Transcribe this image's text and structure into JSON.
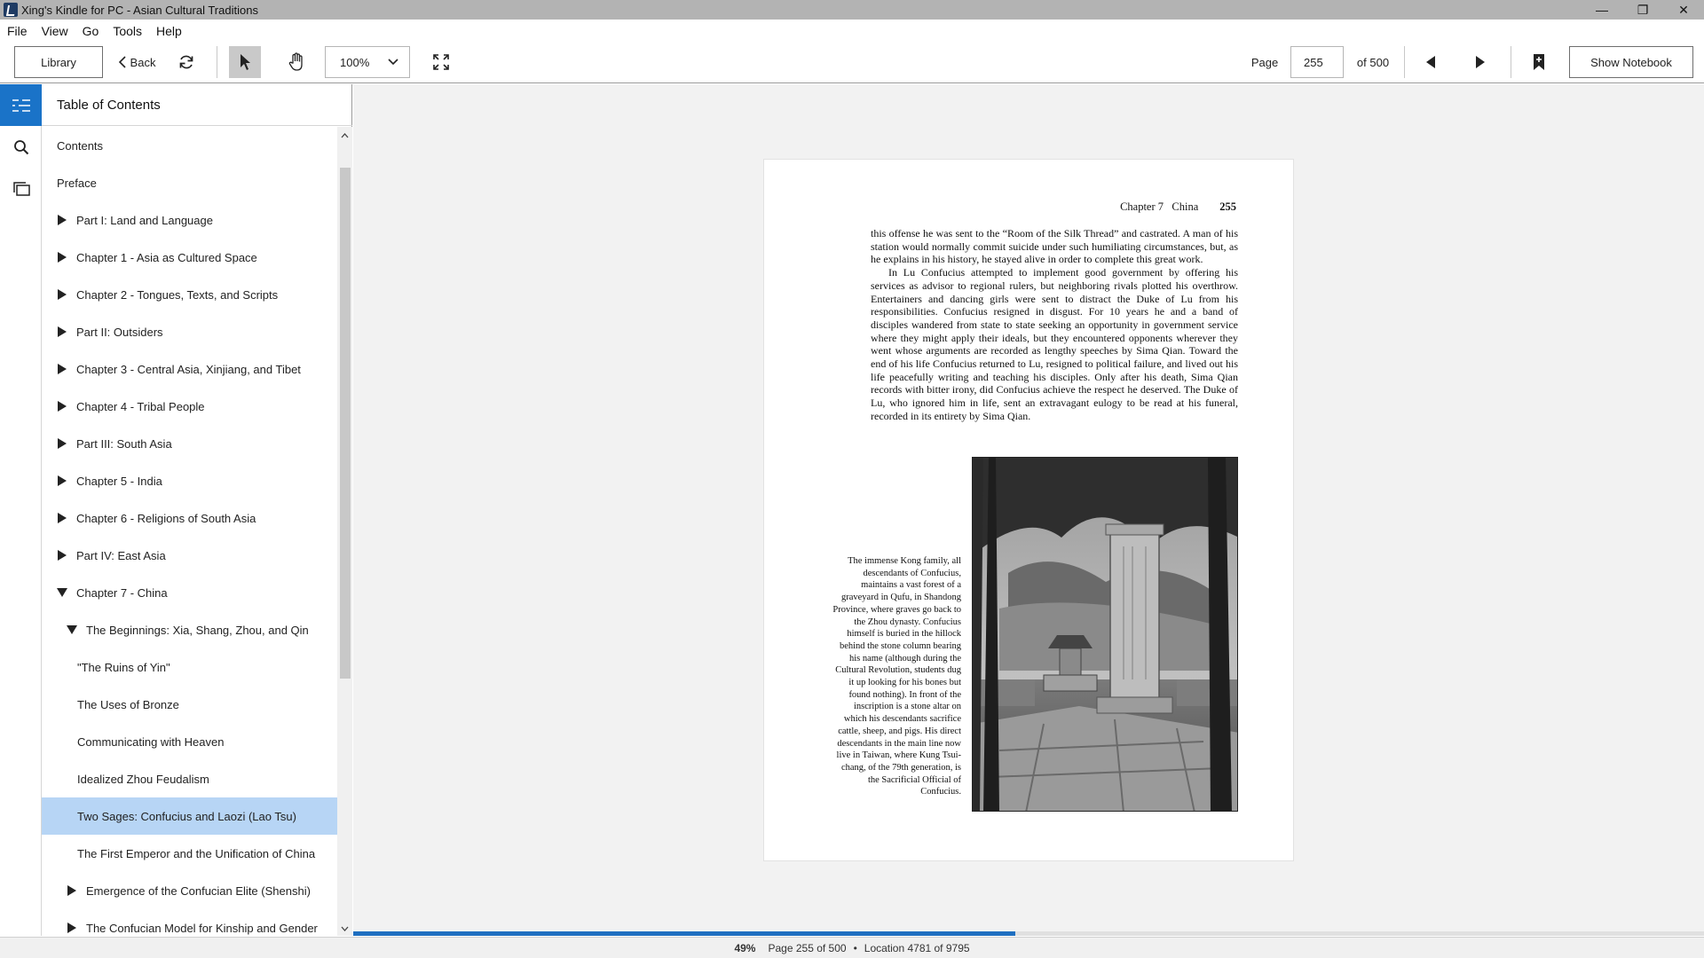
{
  "window": {
    "title": "Xing's Kindle for PC - Asian Cultural Traditions",
    "minimize": "—",
    "restore": "❐",
    "close": "✕"
  },
  "menu": {
    "items": [
      {
        "label": "File"
      },
      {
        "label": "View"
      },
      {
        "label": "Go"
      },
      {
        "label": "Tools"
      },
      {
        "label": "Help"
      }
    ]
  },
  "toolbar": {
    "library_label": "Library",
    "back_label": "Back",
    "zoom_value": "100%",
    "page_label": "Page",
    "page_value": "255",
    "page_of": "of 500",
    "notebook_label": "Show Notebook"
  },
  "icons": {
    "menu": "toc-list-icon",
    "search": "search-icon",
    "cards": "flashcards-icon"
  },
  "colors": {
    "accent": "#1a73c8",
    "selected_row": "#b7d5f5",
    "progress": "#1f6fc0"
  },
  "toc": {
    "title": "Table of Contents",
    "items": [
      {
        "label": "Contents",
        "level": 0,
        "toggle": "none"
      },
      {
        "label": "Preface",
        "level": 0,
        "toggle": "none"
      },
      {
        "label": "Part I: Land and Language",
        "level": 0,
        "toggle": "collapsed"
      },
      {
        "label": "Chapter 1 - Asia as Cultured Space",
        "level": 0,
        "toggle": "collapsed"
      },
      {
        "label": "Chapter 2 - Tongues, Texts, and Scripts",
        "level": 0,
        "toggle": "collapsed"
      },
      {
        "label": "Part II: Outsiders",
        "level": 0,
        "toggle": "collapsed"
      },
      {
        "label": "Chapter 3 - Central Asia, Xinjiang, and Tibet",
        "level": 0,
        "toggle": "collapsed"
      },
      {
        "label": "Chapter 4 - Tribal People",
        "level": 0,
        "toggle": "collapsed"
      },
      {
        "label": "Part III: South Asia",
        "level": 0,
        "toggle": "collapsed"
      },
      {
        "label": "Chapter 5 - India",
        "level": 0,
        "toggle": "collapsed"
      },
      {
        "label": "Chapter 6 - Religions of South Asia",
        "level": 0,
        "toggle": "collapsed"
      },
      {
        "label": "Part IV: East Asia",
        "level": 0,
        "toggle": "collapsed"
      },
      {
        "label": "Chapter 7 - China",
        "level": 0,
        "toggle": "expanded"
      },
      {
        "label": "The Beginnings: Xia, Shang, Zhou, and Qin",
        "level": 1,
        "toggle": "expanded"
      },
      {
        "label": "\"The Ruins of Yin\"",
        "level": 2,
        "toggle": "none"
      },
      {
        "label": "The Uses of Bronze",
        "level": 2,
        "toggle": "none"
      },
      {
        "label": "Communicating with Heaven",
        "level": 2,
        "toggle": "none"
      },
      {
        "label": "Idealized Zhou Feudalism",
        "level": 2,
        "toggle": "none"
      },
      {
        "label": "Two Sages: Confucius and Laozi (Lao Tsu)",
        "level": 2,
        "toggle": "none",
        "selected": true
      },
      {
        "label": "The First Emperor and the Unification of China",
        "level": 2,
        "toggle": "none"
      },
      {
        "label": "Emergence of the Confucian Elite (Shenshi)",
        "level": 1,
        "toggle": "collapsed"
      },
      {
        "label": "The Confucian Model for Kinship and Gender",
        "level": 1,
        "toggle": "collapsed"
      }
    ]
  },
  "book_page": {
    "running_head": "Chapter 7   China",
    "page_number": "255",
    "paragraphs": [
      "this offense he was sent to the “Room of the Silk Thread” and castrated. A man of his station would normally commit suicide under such humiliating circumstances, but, as he explains in his history, he stayed alive in order to complete this great work.",
      "In Lu Confucius attempted to implement good government by offering his services as advisor to regional rulers, but neighboring rivals plotted his overthrow. Entertainers and dancing girls were sent to distract the Duke of Lu from his responsibilities. Confucius resigned in disgust. For 10 years he and a band of disciples wandered from state to state seeking an opportunity in government service where they might apply their ideals, but they encountered opponents wherever they went whose arguments are recorded as lengthy speeches by Sima Qian. Toward the end of his life Confucius returned to Lu, resigned to political failure, and lived out his life peacefully writing and teaching his disciples. Only after his death, Sima Qian records with bitter irony, did Confucius achieve the respect he deserved. The Duke of Lu, who ignored him in life, sent an extravagant eulogy to be read at his funeral, recorded in its entirety by Sima Qian."
    ],
    "caption": "The immense Kong family, all descendants of Confucius, maintains a vast forest of a graveyard in Qufu, in Shandong Province, where graves go back to the Zhou dynasty. Confucius himself is buried in the hillock behind the stone column bearing his name (although during the Cultural Revolution, students dug it up looking for his bones but found nothing). In front of the inscription is a stone altar on which his descendants sacrifice cattle, sheep, and pigs. His direct descendants in the main line now live in Taiwan, where Kung Tsui-chang, of the 79th generation, is the Sacrificial Official of Confucius."
  },
  "status": {
    "percent": "49%",
    "progress_fraction": 0.49,
    "page_info": "Page 255 of 500",
    "separator": "•",
    "location": "Location 4781 of 9795"
  }
}
